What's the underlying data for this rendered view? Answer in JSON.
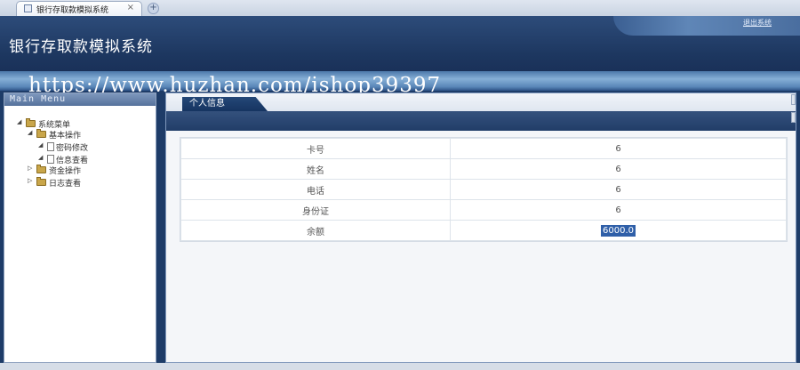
{
  "browser": {
    "tab_title": "银行存取款模拟系统",
    "tab_close": "×",
    "new_tab": "+"
  },
  "header": {
    "title": "银行存取款模拟系统",
    "logout": "退出系统"
  },
  "watermark": "https://www.huzhan.com/ishop39397",
  "sidebar": {
    "title": "Main Menu",
    "tree": {
      "root": "系统菜单",
      "basic": "基本操作",
      "pwd": "密码修改",
      "info": "信息查看",
      "funds": "资金操作",
      "logs": "日志查看"
    }
  },
  "content": {
    "tab": "个人信息",
    "rows": [
      {
        "label": "卡号",
        "value": "6"
      },
      {
        "label": "姓名",
        "value": "6"
      },
      {
        "label": "电话",
        "value": "6"
      },
      {
        "label": "身份证",
        "value": "6"
      },
      {
        "label": "余额",
        "value": "6000.0"
      }
    ]
  },
  "colors": {
    "header_bg": "#1d3760",
    "accent": "#2f5fa8",
    "folder": "#c9a64a"
  }
}
